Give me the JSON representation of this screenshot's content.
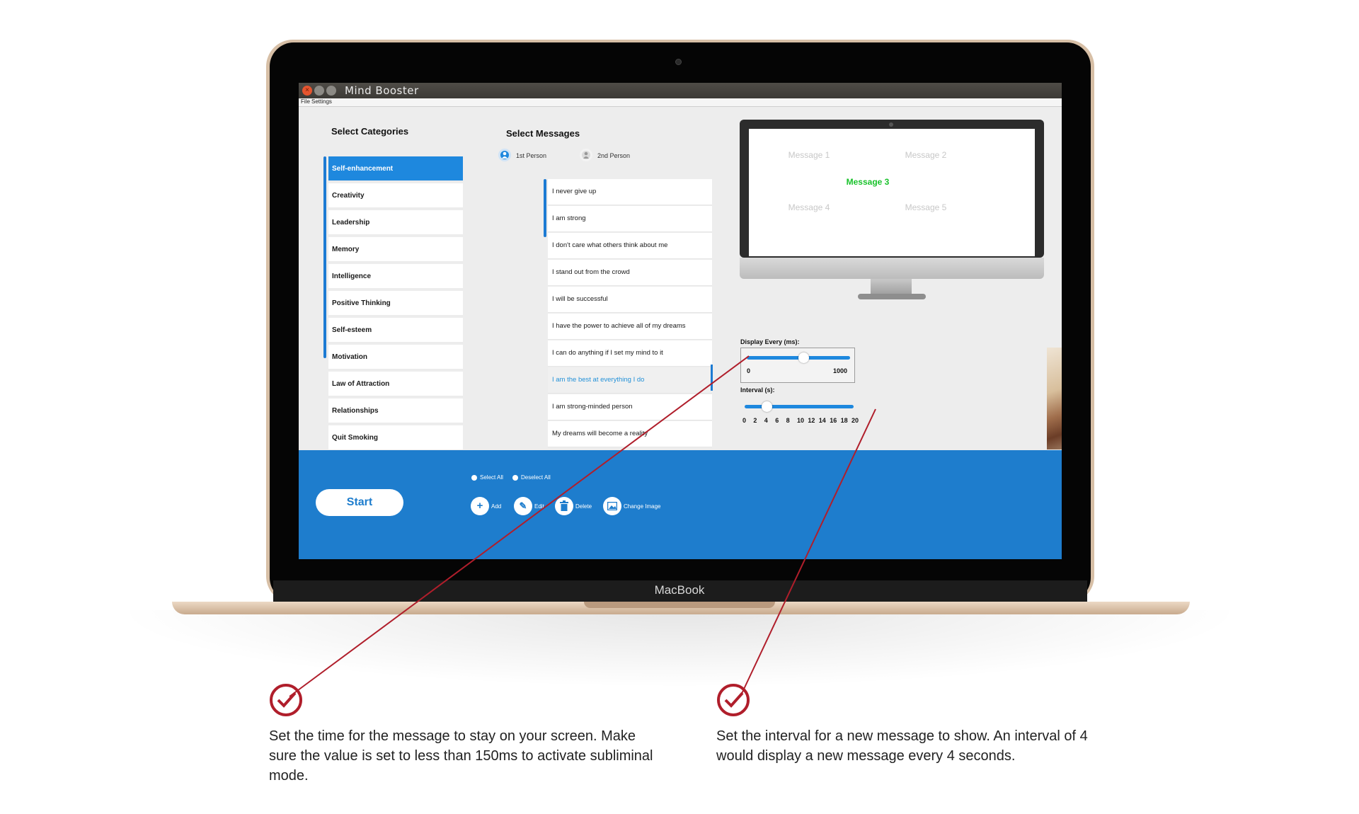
{
  "device": {
    "brand": "MacBook"
  },
  "window": {
    "title": "Mind Booster",
    "menu": [
      "File",
      "Settings"
    ]
  },
  "categories": {
    "title": "Select Categories",
    "items": [
      "Self-enhancement",
      "Creativity",
      "Leadership",
      "Memory",
      "Intelligence",
      "Positive Thinking",
      "Self-esteem",
      "Motivation",
      "Law of Attraction",
      "Relationships",
      "Quit Smoking"
    ],
    "selected": "Self-enhancement"
  },
  "messages": {
    "title": "Select Messages",
    "person_options": [
      "1st Person",
      "2nd Person"
    ],
    "items": [
      "I never give up",
      "I am strong",
      "I don't care what others think about me",
      "I stand out from the crowd",
      "I will be successful",
      "I have the power to achieve all of my dreams",
      "I can do anything if I set my mind to it",
      "I am the best at everything I do",
      "I am strong-minded person",
      "My dreams will become a reality"
    ],
    "highlighted": "I am the best at everything I do"
  },
  "preview": {
    "messages": [
      "Message 1",
      "Message 2",
      "Message 3",
      "Message 4",
      "Message 5"
    ],
    "active": "Message 3"
  },
  "display_every": {
    "label": "Display Every (ms):",
    "min_label": "0",
    "max_label": "1000",
    "value_fraction": 0.55
  },
  "interval": {
    "label": "Interval (s):",
    "ticks": [
      "0",
      "2",
      "4",
      "6",
      "8",
      "10",
      "12",
      "14",
      "16",
      "18",
      "20"
    ],
    "value": 4
  },
  "bottom": {
    "start_label": "Start",
    "select_all": "Select All",
    "deselect_all": "Deselect All",
    "tools": [
      {
        "icon": "add-icon",
        "label": "Add"
      },
      {
        "icon": "edit-icon",
        "label": "Edit"
      },
      {
        "icon": "trash-icon",
        "label": "Delete"
      },
      {
        "icon": "image-icon",
        "label": "Change Image"
      }
    ]
  },
  "annotations": {
    "left": "Set the time for the message to stay on your screen. Make sure the value is set to less than 150ms to activate subliminal mode.",
    "right": "Set the interval for a new message to show. An interval of 4 would display a new message every 4 seconds."
  },
  "colors": {
    "accent": "#1e88de",
    "panel": "#1e7dcd",
    "active_message": "#19c22b",
    "annotation": "#b01e2b"
  }
}
